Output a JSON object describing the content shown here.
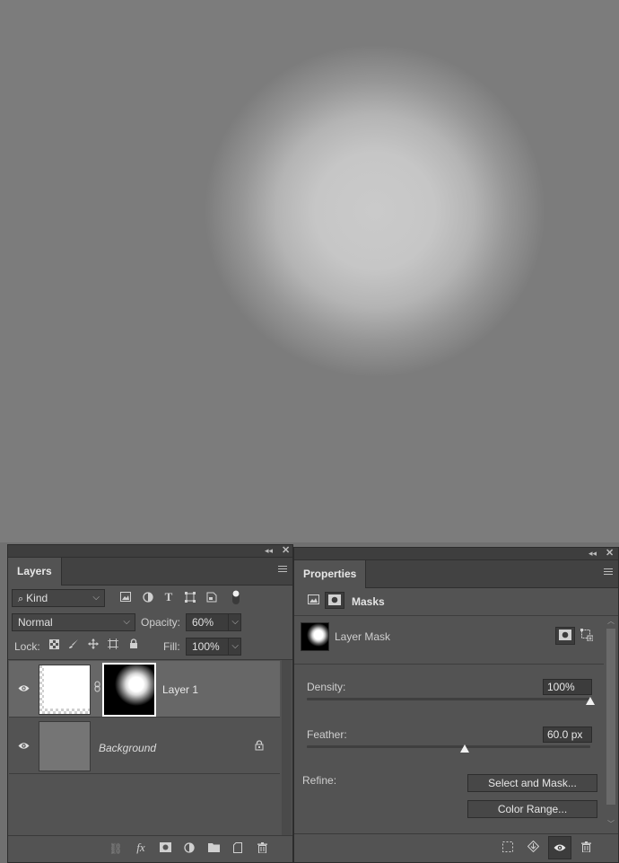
{
  "layers_panel": {
    "title": "Layers",
    "filter": {
      "label": "Kind",
      "icons": [
        "image-filter-icon",
        "adjustment-filter-icon",
        "type-filter-icon",
        "shape-filter-icon",
        "smart-object-filter-icon",
        "filter-toggle-icon"
      ]
    },
    "blend_mode": "Normal",
    "opacity_label": "Opacity:",
    "opacity_value": "60%",
    "lock_label": "Lock:",
    "fill_label": "Fill:",
    "fill_value": "100%",
    "layers": [
      {
        "name": "Layer 1",
        "visible": true,
        "selected": true,
        "has_mask": true
      },
      {
        "name": "Background",
        "visible": true,
        "locked": true
      }
    ],
    "footer_icons": [
      "link-layers-icon",
      "fx-icon",
      "add-mask-icon",
      "adjustment-layer-icon",
      "group-folder-icon",
      "new-layer-icon",
      "trash-icon"
    ]
  },
  "properties_panel": {
    "title": "Properties",
    "section": "Masks",
    "mask_type": "Layer Mask",
    "density_label": "Density:",
    "density_value": "100%",
    "density_fraction": 1.0,
    "feather_label": "Feather:",
    "feather_value": "60.0 px",
    "feather_fraction": 0.5,
    "refine_label": "Refine:",
    "select_and_mask_label": "Select and Mask...",
    "color_range_label": "Color Range...",
    "footer_icons": [
      "load-selection-icon",
      "apply-mask-icon",
      "disable-mask-eye-icon",
      "delete-mask-icon"
    ]
  },
  "colors": {
    "panel": "#535353",
    "canvas": "#757575",
    "highlight": "#c8c8c8"
  }
}
